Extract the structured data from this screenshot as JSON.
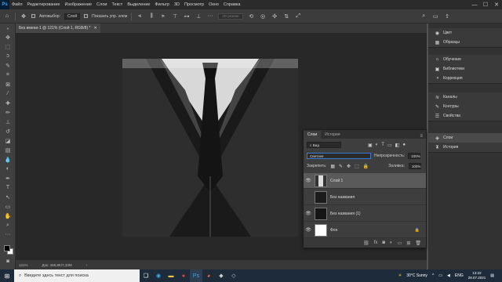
{
  "app": {
    "logo": "Ps"
  },
  "menu": [
    "Файл",
    "Редактирование",
    "Изображение",
    "Слои",
    "Текст",
    "Выделение",
    "Фильтр",
    "3D",
    "Просмотр",
    "Окно",
    "Справка"
  ],
  "window_controls": {
    "minimize": "—",
    "maximize": "☐",
    "close": "✕"
  },
  "options_bar": {
    "autoselect_label": "Автовыбор:",
    "autoselect_value": "Слой",
    "transform_label": "Показать упр. элем",
    "mode_3d_label": "3D-режим:"
  },
  "document_tab": {
    "title": "Без имени-1 @ 121% (Слой 1, RGB/8) *",
    "close": "✕"
  },
  "status_bar": {
    "zoom": "121%",
    "doc_info": "Док: 468,8K/7,33M",
    "arrow": "›"
  },
  "right_panel": {
    "group1": [
      {
        "label": "Цвет",
        "icon": "color-wheel-icon"
      },
      {
        "label": "Образцы",
        "icon": "swatches-icon"
      }
    ],
    "group2": [
      {
        "label": "Обучение",
        "icon": "learn-icon"
      },
      {
        "label": "Библиотеки",
        "icon": "libraries-icon"
      },
      {
        "label": "Коррекция",
        "icon": "adjustments-icon"
      }
    ],
    "group3": [
      {
        "label": "Каналы",
        "icon": "channels-icon"
      },
      {
        "label": "Контуры",
        "icon": "paths-icon"
      },
      {
        "label": "Свойства",
        "icon": "properties-icon"
      }
    ],
    "group4": [
      {
        "label": "Слои",
        "icon": "layers-icon",
        "active": true
      },
      {
        "label": "История",
        "icon": "history-icon"
      }
    ]
  },
  "layers_panel": {
    "tabs": [
      "Слои",
      "История"
    ],
    "filter_label": "Вид",
    "blend_mode": "Светлее",
    "opacity_label": "Непрозрачность:",
    "opacity_value": "100%",
    "lock_label": "Закрепить:",
    "fill_label": "Заливка:",
    "fill_value": "100%",
    "layers": [
      {
        "name": "Слой 1",
        "visible": true,
        "selected": true,
        "thumb": "suit"
      },
      {
        "name": "Без названия",
        "visible": false,
        "selected": false,
        "thumb": "dark"
      },
      {
        "name": "Без названия (1)",
        "visible": true,
        "selected": false,
        "thumb": "dark"
      },
      {
        "name": "Фон",
        "visible": true,
        "selected": false,
        "thumb": "white",
        "locked": true
      }
    ],
    "bottom_icons": [
      "link-icon",
      "fx-icon",
      "mask-icon",
      "adjustment-layer-icon",
      "group-icon",
      "new-layer-icon",
      "delete-icon"
    ]
  },
  "taskbar": {
    "search_placeholder": "Введите здесь текст для поиска",
    "weather": "30°C  Sunny",
    "language": "ENG",
    "time": "13:22",
    "date": "28.07.2021"
  },
  "colors": {
    "ps_blue": "#31a8ff",
    "taskbar": "#1d2b3a",
    "selected_layer": "#5a5a5a"
  }
}
